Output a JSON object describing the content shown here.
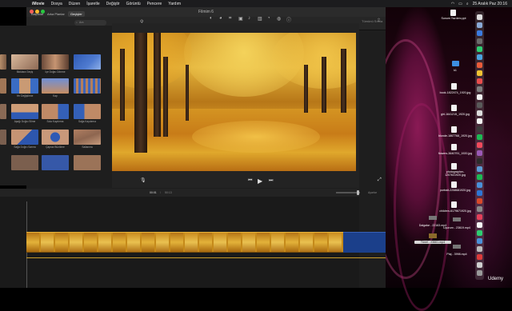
{
  "menubar": {
    "app": "iMovie",
    "items": [
      "Dosya",
      "Düzen",
      "İşaretle",
      "Değiştir",
      "Görüntü",
      "Pencere",
      "Yardım"
    ],
    "clock": "25 Aralık Paz  20:16"
  },
  "window": {
    "title": "Filmim 6"
  },
  "browser": {
    "tabs": [
      "Başlıklar",
      "Arka Planlar",
      "Geçişler"
    ],
    "active_tab": "Geçişler",
    "search_placeholder": "Ara",
    "transitions": [
      "Bloklara Geçiş",
      "İçe Doğru Dönme",
      "Yer Değiştirme",
      "Kap",
      "Aşağı Doğru Silme",
      "Sola Kaydırma",
      "Sağa Kaydırma",
      "Sağa Doğru Sarma",
      "Çapraz Büzülme",
      "Sallanma"
    ]
  },
  "viewer": {
    "reset_label": "Tümünü Sıfırla"
  },
  "timeline": {
    "timecode": "00:01",
    "duration": "50:13",
    "settings_label": "Ayarlar"
  },
  "desktop_files": [
    "Sunum Yazılımı.ppt",
    "k1",
    "book-1822474_1920.jpg",
    "girl-1641215_1920.jpg",
    "blonde-1867768_1920.jpg",
    "flowers-3640791_1920.jpg",
    "photographer-1207631920.jpg",
    "portrait-2258681920.jpg",
    "children-6179671920.jpg",
    "Dalgalar - 22163.mp4",
    "Uçurum - 23619.mp4",
    "Tünel - 23661.mp4",
    "Plaj - 3998.mp4"
  ],
  "watermark": "Udemy",
  "colors": {
    "accent": "#e3b23a",
    "timeline_blue": "#1b3f8a"
  }
}
